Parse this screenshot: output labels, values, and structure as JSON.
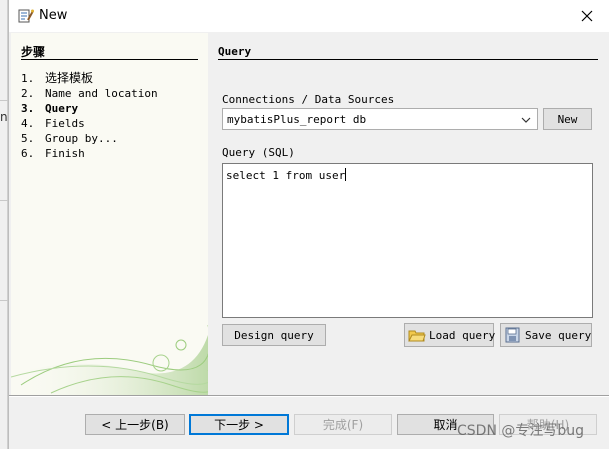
{
  "window": {
    "title": "New",
    "icon": "report-wizard-icon",
    "close_icon": "close-icon"
  },
  "backdrop": {
    "fragment": "na"
  },
  "steps": {
    "title": "步骤",
    "items": [
      {
        "num": "1.",
        "label": "选择模板"
      },
      {
        "num": "2.",
        "label": "Name and location"
      },
      {
        "num": "3.",
        "label": "Query"
      },
      {
        "num": "4.",
        "label": "Fields"
      },
      {
        "num": "5.",
        "label": "Group by..."
      },
      {
        "num": "6.",
        "label": "Finish"
      }
    ],
    "active_index": 2
  },
  "query": {
    "section_title": "Query",
    "connections_label": "Connections / Data Sources",
    "connection_value": "mybatisPlus_report db",
    "new_button": "New",
    "sql_label": "Query (SQL)",
    "sql_text": "select 1 from user",
    "design_button": "Design query",
    "load_button": "Load query",
    "save_button": "Save query"
  },
  "nav": {
    "prev": "< 上一步(B)",
    "next": "下一步 >",
    "finish": "完成(F)",
    "cancel": "取消",
    "help": "帮助(H)"
  },
  "watermark": "CSDN @专注写bug",
  "colors": {
    "accent": "#0078d7",
    "panel": "#fafaf3",
    "swirl": "#8bbf6a"
  }
}
